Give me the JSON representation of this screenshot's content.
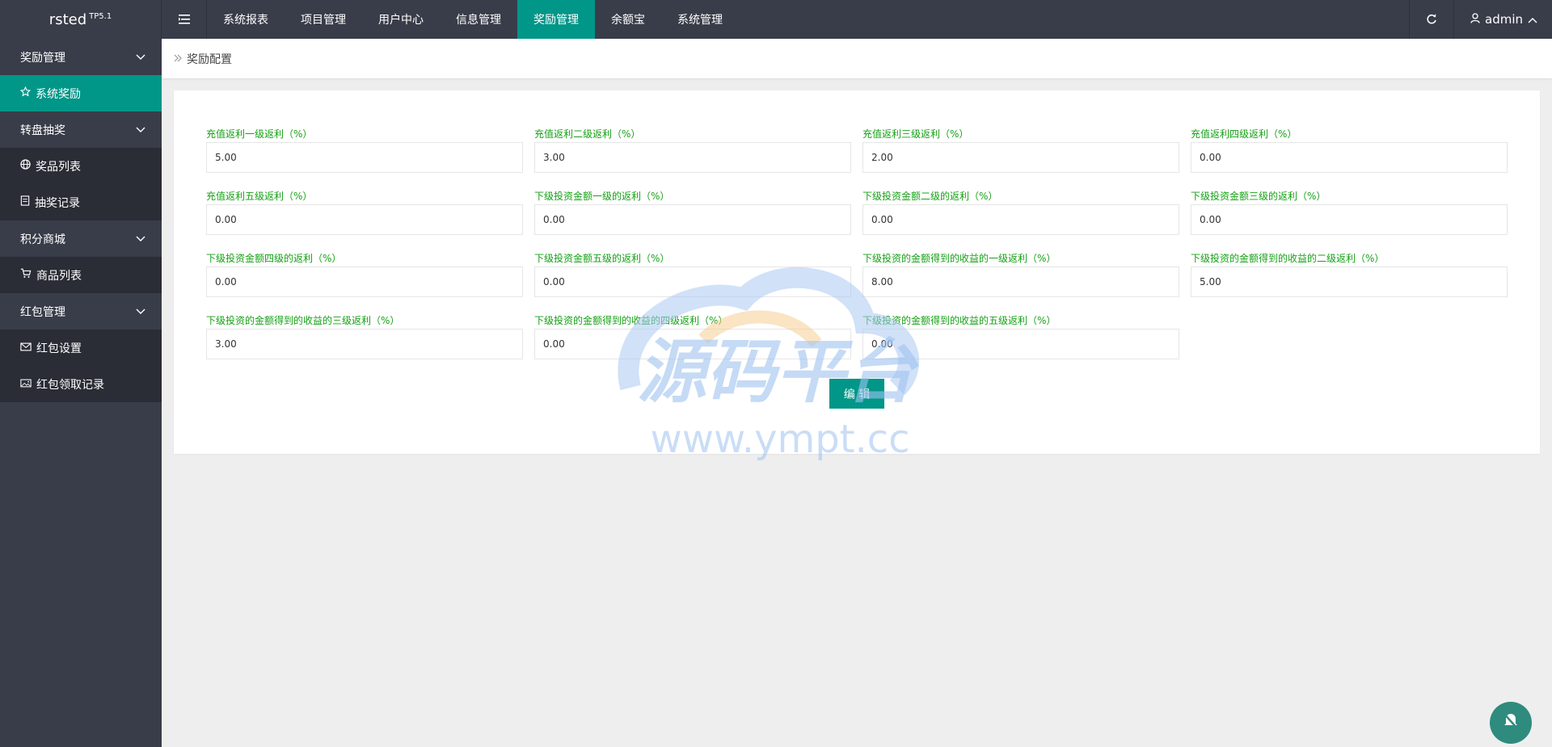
{
  "brand": {
    "name": "rsted",
    "version": "TP5.1"
  },
  "topnav": {
    "items": [
      {
        "label": "系统报表",
        "active": false
      },
      {
        "label": "项目管理",
        "active": false
      },
      {
        "label": "用户中心",
        "active": false
      },
      {
        "label": "信息管理",
        "active": false
      },
      {
        "label": "奖励管理",
        "active": true
      },
      {
        "label": "余额宝",
        "active": false
      },
      {
        "label": "系统管理",
        "active": false
      }
    ],
    "user": "admin"
  },
  "sidebar": {
    "groups": [
      {
        "label": "奖励管理",
        "items": [
          {
            "label": "系统奖励",
            "icon": "star-icon",
            "active": true
          }
        ]
      },
      {
        "label": "转盘抽奖",
        "items": [
          {
            "label": "奖品列表",
            "icon": "globe-icon"
          },
          {
            "label": "抽奖记录",
            "icon": "document-icon"
          }
        ]
      },
      {
        "label": "积分商城",
        "items": [
          {
            "label": "商品列表",
            "icon": "cart-icon"
          }
        ]
      },
      {
        "label": "红包管理",
        "items": [
          {
            "label": "红包设置",
            "icon": "envelope-icon"
          },
          {
            "label": "红包领取记录",
            "icon": "image-icon"
          }
        ]
      }
    ]
  },
  "breadcrumb": {
    "current": "奖励配置"
  },
  "form": {
    "fields": [
      {
        "label": "充值返利一级返利（%）",
        "value": "5.00"
      },
      {
        "label": "充值返利二级返利（%）",
        "value": "3.00"
      },
      {
        "label": "充值返利三级返利（%）",
        "value": "2.00"
      },
      {
        "label": "充值返利四级返利（%）",
        "value": "0.00"
      },
      {
        "label": "充值返利五级返利（%）",
        "value": "0.00"
      },
      {
        "label": "下级投资金额一级的返利（%）",
        "value": "0.00"
      },
      {
        "label": "下级投资金额二级的返利（%）",
        "value": "0.00"
      },
      {
        "label": "下级投资金额三级的返利（%）",
        "value": "0.00"
      },
      {
        "label": "下级投资金额四级的返利（%）",
        "value": "0.00"
      },
      {
        "label": "下级投资金额五级的返利（%）",
        "value": "0.00"
      },
      {
        "label": "下级投资的金额得到的收益的一级返利（%）",
        "value": "8.00"
      },
      {
        "label": "下级投资的金额得到的收益的二级返利（%）",
        "value": "5.00"
      },
      {
        "label": "下级投资的金额得到的收益的三级返利（%）",
        "value": "3.00"
      },
      {
        "label": "下级投资的金额得到的收益的四级返利（%）",
        "value": "0.00"
      },
      {
        "label": "下级投资的金额得到的收益的五级返利（%）",
        "value": "0.00"
      }
    ],
    "submit_label": "编 辑"
  },
  "watermark": {
    "title": "源码平台",
    "url": "www.ympt.cc"
  },
  "colors": {
    "accent": "#009688",
    "sidebar": "#393d49",
    "label_green": "#16a116"
  }
}
